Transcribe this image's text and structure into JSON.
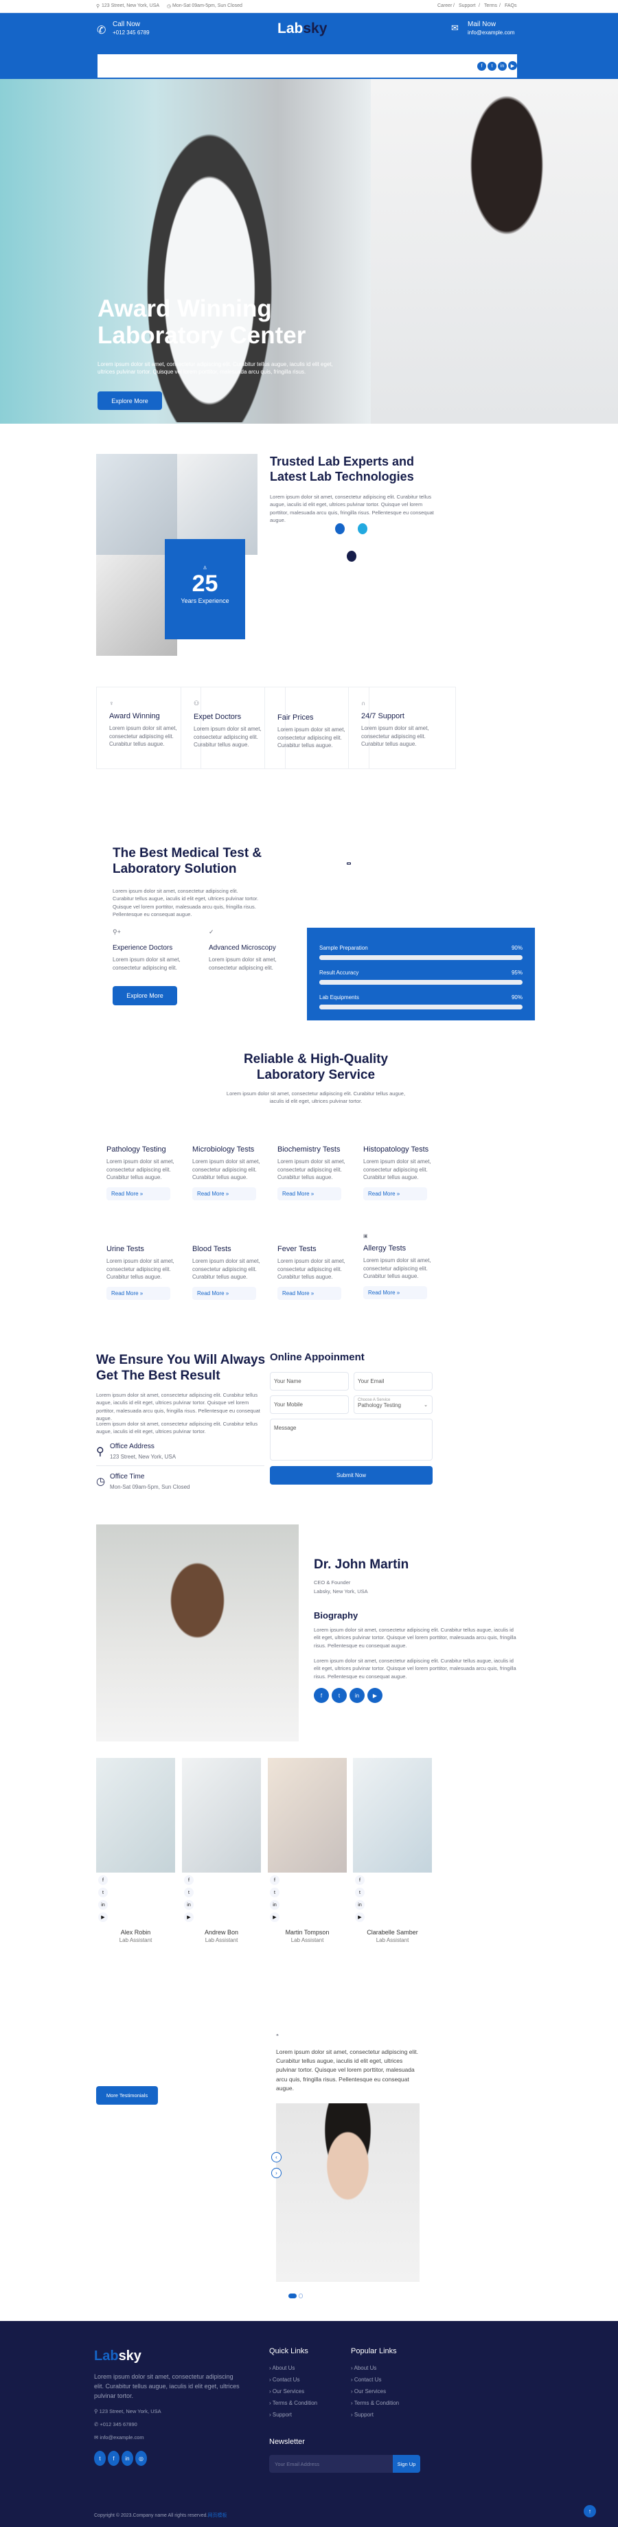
{
  "topbar": {
    "address": "123 Street, New York, USA",
    "hours": "Mon-Sat 09am-5pm, Sun Closed",
    "links": [
      "Career",
      "Support",
      "Terms",
      "FAQs"
    ]
  },
  "header": {
    "call_label": "Call Now",
    "phone": "+012 345 6789",
    "logo_a": "Lab",
    "logo_b": "sky",
    "mail_label": "Mail Now",
    "email": "info@example.com"
  },
  "hero": {
    "title_1": "Award Winning",
    "title_2": "Laboratory Center",
    "text": "Lorem ipsum dolor sit amet, consectetur adipiscing elit. Curabitur tellus augue, iaculis id elit eget, ultrices pulvinar tortor. Quisque vel lorem porttitor, malesuada arcu quis, fringilla risus.",
    "button": "Explore More"
  },
  "about": {
    "years": "25",
    "years_label": "Years Experience",
    "title": "Trusted Lab Experts and Latest Lab Technologies",
    "text": "Lorem ipsum dolor sit amet, consectetur adipiscing elit. Curabitur tellus augue, iaculis id elit eget, ultrices pulvinar tortor. Quisque vel lorem porttitor, malesuada arcu quis, fringilla risus. Pellentesque eu consequat augue."
  },
  "features": [
    {
      "icon": "award-icon",
      "title": "Award Winning",
      "text": "Lorem ipsum dolor sit amet, consectetur adipiscing elit. Curabitur tellus augue."
    },
    {
      "icon": "users-icon",
      "title": "Expet Doctors",
      "text": "Lorem ipsum dolor sit amet, consectetur adipiscing elit. Curabitur tellus augue."
    },
    {
      "icon": "",
      "title": "Fair Prices",
      "text": "Lorem ipsum dolor sit amet, consectetur adipiscing elit. Curabitur tellus augue."
    },
    {
      "icon": "headphones-icon",
      "title": "24/7 Support",
      "text": "Lorem ipsum dolor sit amet, consectetur adipiscing elit. Curabitur tellus augue."
    }
  ],
  "solution": {
    "title": "The Best Medical Test & Laboratory Solution",
    "text": "Lorem ipsum dolor sit amet, consectetur adipiscing elit. Curabitur tellus augue, iaculis id elit eget, ultrices pulvinar tortor. Quisque vel lorem porttitor, malesuada arcu quis, fringilla risus. Pellentesque eu consequat augue.",
    "items": [
      {
        "title": "Experience Doctors",
        "text": "Lorem ipsum dolor sit amet, consectetur adipiscing elit."
      },
      {
        "title": "Advanced Microscopy",
        "text": "Lorem ipsum dolor sit amet, consectetur adipiscing elit."
      }
    ],
    "button": "Explore More",
    "progress": [
      {
        "label": "Sample Preparation",
        "value": "90%"
      },
      {
        "label": "Result Accuracy",
        "value": "95%"
      },
      {
        "label": "Lab Equipments",
        "value": "90%"
      }
    ]
  },
  "services": {
    "title_1": "Reliable & High-Quality",
    "title_2": "Laboratory Service",
    "text": "Lorem ipsum dolor sit amet, consectetur adipiscing elit. Curabitur tellus augue, iaculis id elit eget, ultrices pulvinar tortor.",
    "read_more": "Read More »",
    "items": [
      {
        "title": "Pathology Testing"
      },
      {
        "title": "Microbiology Tests"
      },
      {
        "title": "Biochemistry Tests"
      },
      {
        "title": "Histopatology Tests"
      },
      {
        "title": "Urine Tests"
      },
      {
        "title": "Blood Tests"
      },
      {
        "title": "Fever Tests"
      },
      {
        "title": "Allergy Tests"
      }
    ],
    "item_text": "Lorem ipsum dolor sit amet, consectetur adipiscing elit. Curabitur tellus augue."
  },
  "ensure": {
    "title": "We Ensure You Will Always Get The Best Result",
    "text1": "Lorem ipsum dolor sit amet, consectetur adipiscing elit. Curabitur tellus augue, iaculis id elit eget, ultrices pulvinar tortor. Quisque vel lorem porttitor, malesuada arcu quis, fringilla risus. Pellentesque eu consequat augue.",
    "text2": "Lorem ipsum dolor sit amet, consectetur adipiscing elit. Curabitur tellus augue, iaculis id elit eget, ultrices pulvinar tortor.",
    "address_label": "Office Address",
    "address": "123 Street, New York, USA",
    "time_label": "Office Time",
    "time": "Mon-Sat 09am-5pm, Sun Closed"
  },
  "appointment": {
    "title": "Online Appoinment",
    "name": "Your Name",
    "email": "Your Email",
    "mobile": "Your Mobile",
    "service_label": "Choose A Service",
    "service_value": "Pathology Testing",
    "message": "Message",
    "submit": "Submit Now"
  },
  "doctor": {
    "name": "Dr. John Martin",
    "role": "CEO & Founder",
    "location": "Labsky, New York, USA",
    "bio_title": "Biography",
    "bio1": "Lorem ipsum dolor sit amet, consectetur adipiscing elit. Curabitur tellus augue, iaculis id elit eget, ultrices pulvinar tortor. Quisque vel lorem porttitor, malesuada arcu quis, fringilla risus. Pellentesque eu consequat augue.",
    "bio2": "Lorem ipsum dolor sit amet, consectetur adipiscing elit. Curabitur tellus augue, iaculis id elit eget, ultrices pulvinar tortor. Quisque vel lorem porttitor, malesuada arcu quis, fringilla risus. Pellentesque eu consequat augue."
  },
  "team": [
    {
      "name": "Alex Robin",
      "role": "Lab Assistant"
    },
    {
      "name": "Andrew Bon",
      "role": "Lab Assistant"
    },
    {
      "name": "Martin Tompson",
      "role": "Lab Assistant"
    },
    {
      "name": "Clarabelle Samber",
      "role": "Lab Assistant"
    }
  ],
  "testimonial": {
    "button": "More Testimonials",
    "text": "Lorem ipsum dolor sit amet, consectetur adipiscing elit. Curabitur tellus augue, iaculis id elit eget, ultrices pulvinar tortor. Quisque vel lorem porttitor, malesuada arcu quis, fringilla risus. Pellentesque eu consequat augue."
  },
  "footer": {
    "logo_a": "Lab",
    "logo_b": "sky",
    "text": "Lorem ipsum dolor sit amet, consectetur adipiscing elit. Curabitur tellus augue, iaculis id elit eget, ultrices pulvinar tortor.",
    "address": "123 Street, New York, USA",
    "phone": "+012 345 67890",
    "email": "info@example.com",
    "quick_title": "Quick Links",
    "popular_title": "Popular Links",
    "links": [
      "About Us",
      "Contact Us",
      "Our Services",
      "Terms & Condition",
      "Support"
    ],
    "newsletter_title": "Newsletter",
    "newsletter_placeholder": "Your Email Address",
    "signup": "Sign Up",
    "copyright": "Copyright © 2023.Company name All rights reserved.",
    "copyright_link": "网页模板"
  },
  "colors": {
    "primary": "#1565c8",
    "navy": "#161d4a",
    "footer_bg": "#161b47"
  }
}
